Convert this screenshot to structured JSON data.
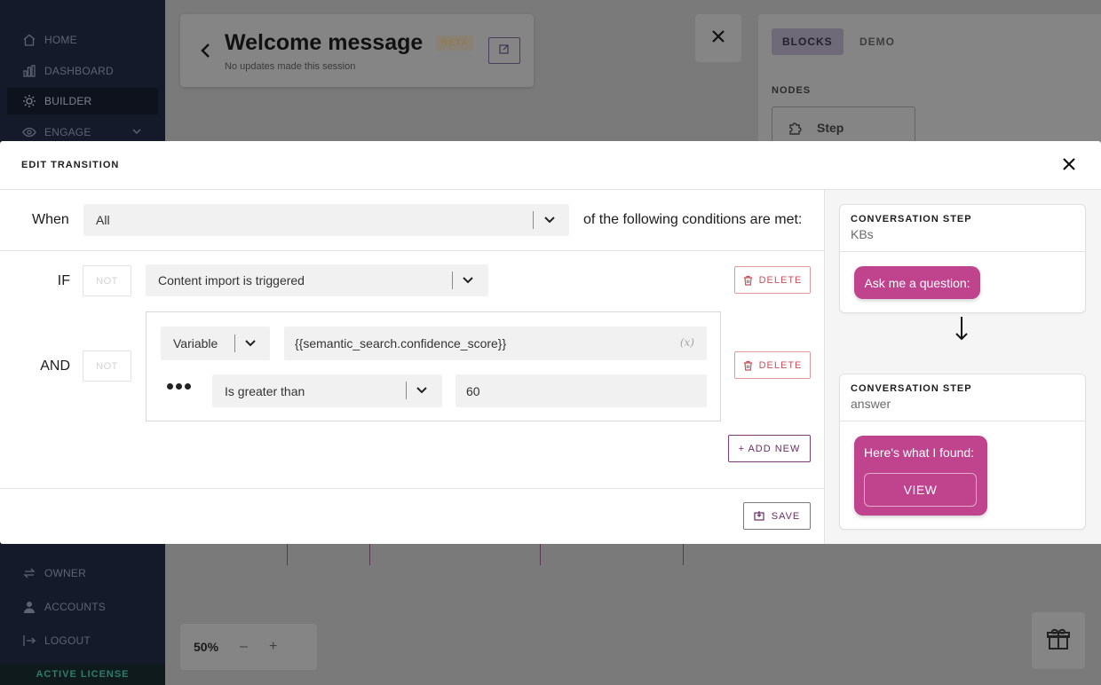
{
  "sidebar": {
    "items": [
      {
        "label": "HOME",
        "icon": "home-icon"
      },
      {
        "label": "DASHBOARD",
        "icon": "bar-chart-icon"
      },
      {
        "label": "BUILDER",
        "icon": "builder-icon",
        "active": true
      },
      {
        "label": "ENGAGE",
        "icon": "eye-icon"
      },
      {
        "label": "OWNER",
        "icon": "transfer-icon"
      },
      {
        "label": "ACCOUNTS",
        "icon": "user-icon"
      },
      {
        "label": "LOGOUT",
        "icon": "logout-icon"
      }
    ],
    "license": "ACTIVE LICENSE"
  },
  "header": {
    "title": "Welcome message",
    "badge": "BETA",
    "subtitle": "No updates made this session"
  },
  "right_panel": {
    "tabs": [
      "BLOCKS",
      "DEMO"
    ],
    "section": "NODES",
    "node": "Step"
  },
  "zoom": {
    "level": "50%",
    "minus": "–",
    "plus": "+"
  },
  "modal": {
    "title": "EDIT TRANSITION",
    "when_label": "When",
    "when_value": "All",
    "when_suffix": "of the following conditions are met:",
    "conditions": [
      {
        "label": "IF",
        "not": "NOT",
        "trigger": "Content import is triggered",
        "delete": "DELETE"
      },
      {
        "label": "AND",
        "not": "NOT",
        "type": "Variable",
        "variable": "{{semantic_search.confidence_score}}",
        "fx": "(x)",
        "operator": "Is greater than",
        "value": "60",
        "delete": "DELETE"
      }
    ],
    "add_new": "+ ADD NEW",
    "save": "SAVE"
  },
  "preview": {
    "steps": [
      {
        "kicker": "CONVERSATION STEP",
        "name": "KBs",
        "bubble": "Ask me a question:"
      },
      {
        "kicker": "CONVERSATION STEP",
        "name": "answer",
        "bubble": "Here's what I found:",
        "button": "VIEW"
      }
    ]
  },
  "colors": {
    "accent": "#c0438d",
    "sidebar": "#141a2a",
    "delete": "#c94f5b",
    "primary_border": "#7b3b75"
  }
}
